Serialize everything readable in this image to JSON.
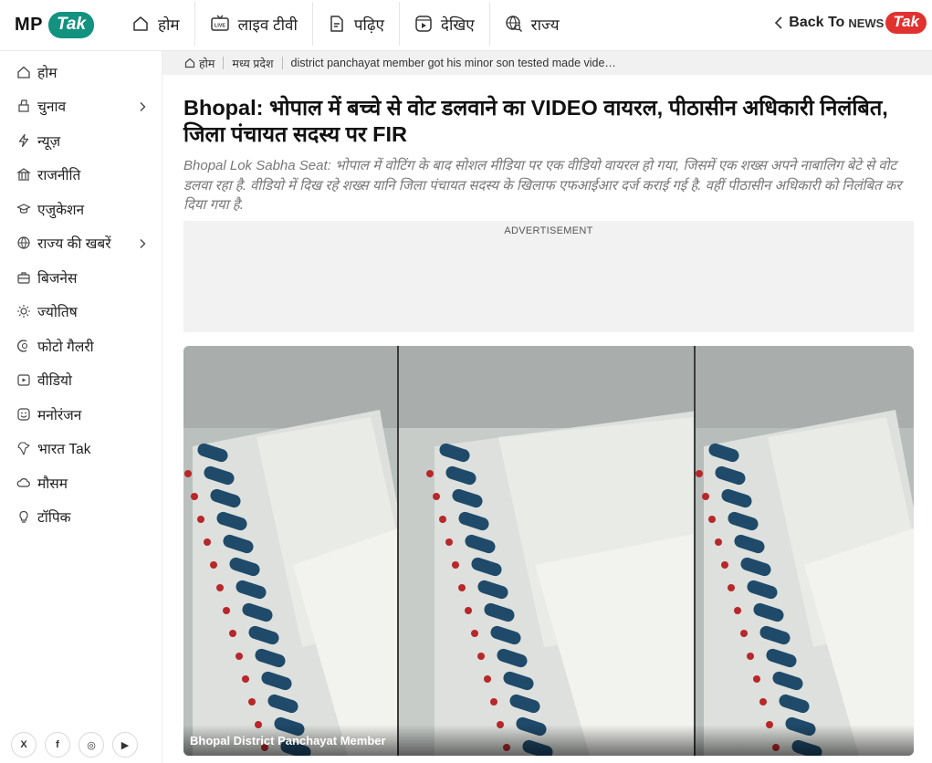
{
  "brand": {
    "mp": "MP",
    "tak": "Tak"
  },
  "topnav": [
    {
      "label": "होम",
      "icon": "home-icon"
    },
    {
      "label": "लाइव टीवी",
      "icon": "live-tv-icon"
    },
    {
      "label": "पढ़िए",
      "icon": "document-icon"
    },
    {
      "label": "देखिए",
      "icon": "video-play-icon"
    },
    {
      "label": "राज्य",
      "icon": "globe-search-icon"
    }
  ],
  "back": {
    "label": "Back To",
    "news": "NEWS",
    "tak": "Tak"
  },
  "sidebar": {
    "items": [
      {
        "label": "होम",
        "icon": "home-icon",
        "has_arrow": false
      },
      {
        "label": "चुनाव",
        "icon": "ballot-icon",
        "has_arrow": true
      },
      {
        "label": "न्यूज़",
        "icon": "lightning-icon",
        "has_arrow": false
      },
      {
        "label": "राजनीति",
        "icon": "parliament-icon",
        "has_arrow": false
      },
      {
        "label": "एजुकेशन",
        "icon": "graduation-cap-icon",
        "has_arrow": false
      },
      {
        "label": "राज्य की खबरें",
        "icon": "globe-icon",
        "has_arrow": true
      },
      {
        "label": "बिजनेस",
        "icon": "briefcase-icon",
        "has_arrow": false
      },
      {
        "label": "ज्योतिष",
        "icon": "astrology-icon",
        "has_arrow": false
      },
      {
        "label": "फोटो गैलरी",
        "icon": "gallery-icon",
        "has_arrow": false
      },
      {
        "label": "वीडियो",
        "icon": "video-icon",
        "has_arrow": false
      },
      {
        "label": "मनोरंजन",
        "icon": "smiley-icon",
        "has_arrow": false
      },
      {
        "label": "भारत Tak",
        "icon": "india-map-icon",
        "has_arrow": false
      },
      {
        "label": "मौसम",
        "icon": "weather-icon",
        "has_arrow": false
      },
      {
        "label": "टॉपिक",
        "icon": "bulb-icon",
        "has_arrow": false
      }
    ],
    "socials": [
      {
        "label": "X",
        "icon": "x-twitter-icon"
      },
      {
        "label": "f",
        "icon": "facebook-icon"
      },
      {
        "label": "◎",
        "icon": "instagram-icon"
      },
      {
        "label": "▶",
        "icon": "youtube-icon"
      }
    ]
  },
  "breadcrumb": {
    "home": "होम",
    "state": "मध्य प्रदेश",
    "current": "district panchayat member got his minor son tested made vide…"
  },
  "article": {
    "title": "Bhopal: भोपाल में बच्चे से वोट डलवाने का VIDEO वायरल, पीठासीन अधिकारी निलंबित, जिला पंचायत सदस्य पर FIR",
    "summary": "Bhopal Lok Sabha Seat: भोपाल में वोटिंग के बाद सोशल मीडिया पर एक वीडियो वायरल हो गया, जिसमें एक शख्स अपने नाबालिग बेटे से वोट डलवा रहा है. वीडियो में दिख रहे शख्स यानि जिला पंचायत सदस्य के खिलाफ एफआईआर दर्ज कराई गई है. वहीं पीठासीन अधिकारी को निलंबित कर दिया गया है.",
    "ad_label": "ADVERTISEMENT",
    "image_caption": "Bhopal District Panchayat Member"
  },
  "colors": {
    "brand_green": "#12927f",
    "newstak_red": "#e0322f",
    "evm_button_blue": "#1f4a6a",
    "indicator_red": "#b8272a"
  }
}
